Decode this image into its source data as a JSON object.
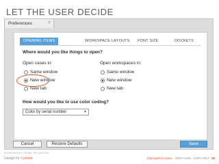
{
  "slide": {
    "title": "LET THE USER DECIDE"
  },
  "window": {
    "tab_label": "Preferences",
    "close_glyph": "×"
  },
  "tabs": [
    "OPENING ITEMS",
    "WORKSPACE LAYOUTS",
    "FONT SIZE",
    "DOCKETS"
  ],
  "section_open": {
    "heading": "Where would you like things to open?",
    "cases": {
      "label": "Open cases in:",
      "options": [
        "Same window",
        "New window",
        "New tab"
      ],
      "selected": "New window"
    },
    "workspaces": {
      "label": "Open workspaces in:",
      "options": [
        "Same window",
        "New window",
        "New tab"
      ],
      "selected": "New window"
    }
  },
  "section_color": {
    "heading": "How would you like to use color coding?",
    "select_value": "Color by serial number"
  },
  "buttons": {
    "cancel": "Cancel",
    "restore": "Restore Defaults",
    "save": "Save"
  },
  "caption": "SCREENSHOT FROM THE DIALOG",
  "footer": {
    "left_prefix": "Design for ",
    "left_accent": "Context",
    "right_handle": "@designforcontext",
    "right_text": " · Seth Forest · UXPA 2017",
    "page": "38"
  },
  "colors": {
    "accent_blue": "#5aa0d8",
    "highlight_orange": "#e0592a"
  },
  "icons": {
    "dropdown": "chevron-down-icon",
    "close": "close-icon"
  }
}
